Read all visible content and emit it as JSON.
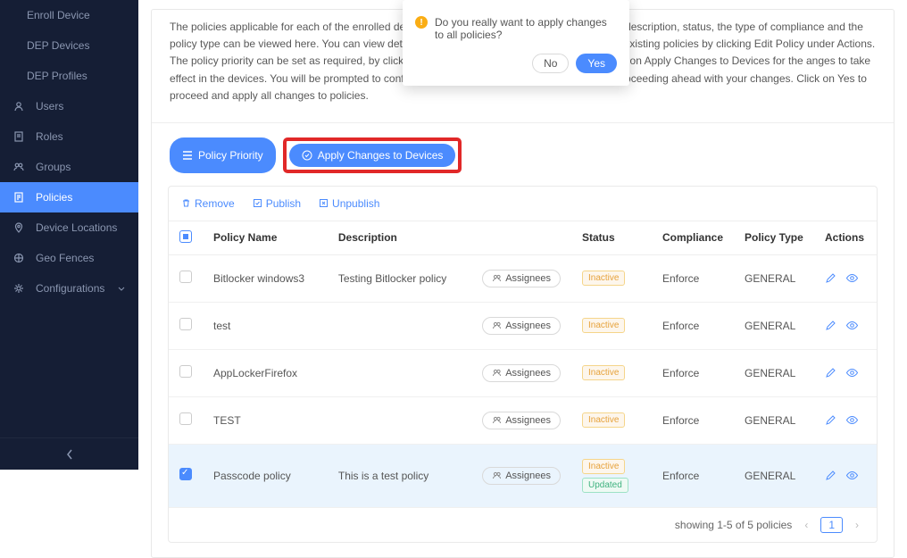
{
  "sidebar": {
    "items": [
      {
        "label": "Enroll Device",
        "sub": true
      },
      {
        "label": "DEP Devices",
        "sub": true
      },
      {
        "label": "DEP Profiles",
        "sub": true
      },
      {
        "label": "Users"
      },
      {
        "label": "Roles"
      },
      {
        "label": "Groups"
      },
      {
        "label": "Policies",
        "active": true
      },
      {
        "label": "Device Locations"
      },
      {
        "label": "Geo Fences"
      },
      {
        "label": "Configurations",
        "expandable": true
      }
    ]
  },
  "description_text": "The policies applicable for each of the enrolled devices are displayed here. The policy name, its description, status, the type of compliance and the policy type can be viewed here. You can view details of a policy by clicking View Policy and edit existing policies by clicking Edit Policy under Actions. The policy priority can be set as required, by clicking Policy Priority and editing the policies. Click on Apply Changes to Devices for the anges to take effect in the devices. You will be prompted to confirm your action by clicking Yes, or No for not proceeding ahead with your changes. Click on Yes to proceed and apply all changes to policies.",
  "buttons": {
    "policy_priority": "Policy Priority",
    "apply_changes": "Apply Changes to Devices"
  },
  "popover": {
    "message": "Do you really want to apply changes to all policies?",
    "no": "No",
    "yes": "Yes"
  },
  "toolbar": {
    "remove": "Remove",
    "publish": "Publish",
    "unpublish": "Unpublish"
  },
  "table": {
    "headers": {
      "name": "Policy Name",
      "desc": "Description",
      "status": "Status",
      "compliance": "Compliance",
      "type": "Policy Type",
      "actions": "Actions"
    },
    "assignees_label": "Assignees",
    "rows": [
      {
        "name": "Bitlocker windows3",
        "desc": "Testing Bitlocker policy",
        "status": [
          "Inactive"
        ],
        "compliance": "Enforce",
        "type": "GENERAL",
        "selected": false
      },
      {
        "name": "test",
        "desc": "",
        "status": [
          "Inactive"
        ],
        "compliance": "Enforce",
        "type": "GENERAL",
        "selected": false
      },
      {
        "name": "AppLockerFirefox",
        "desc": "",
        "status": [
          "Inactive"
        ],
        "compliance": "Enforce",
        "type": "GENERAL",
        "selected": false
      },
      {
        "name": "TEST",
        "desc": "",
        "status": [
          "Inactive"
        ],
        "compliance": "Enforce",
        "type": "GENERAL",
        "selected": false
      },
      {
        "name": "Passcode policy",
        "desc": "This is a test policy",
        "status": [
          "Inactive",
          "Updated"
        ],
        "compliance": "Enforce",
        "type": "GENERAL",
        "selected": true
      }
    ]
  },
  "pager": {
    "text": "showing 1-5 of 5 policies",
    "current": "1"
  }
}
